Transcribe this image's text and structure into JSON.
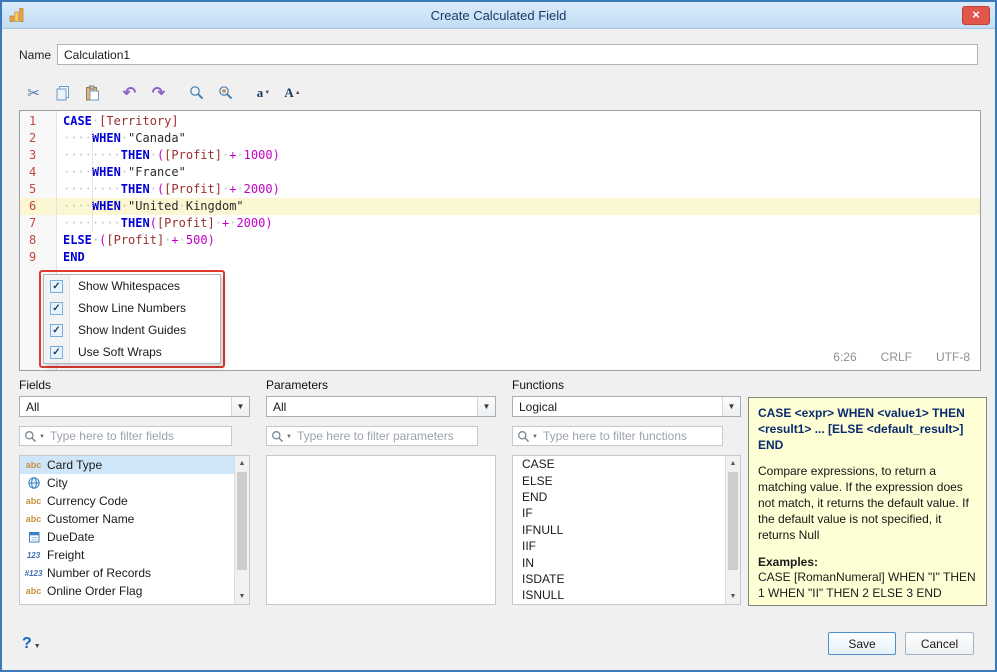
{
  "window": {
    "title": "Create Calculated Field",
    "close_glyph": "×"
  },
  "name_row": {
    "label": "Name",
    "value": "Calculation1"
  },
  "toolbar": {
    "cut_glyph": "✂",
    "undo_glyph": "↶",
    "redo_glyph": "↷",
    "font_decrease_glyph": "a",
    "font_increase_glyph": "A"
  },
  "editor": {
    "lines": [
      {
        "num": "1",
        "hl": false,
        "tokens": [
          [
            "kw",
            "CASE"
          ],
          [
            "ws",
            "·"
          ],
          [
            "field",
            "[Territory]"
          ]
        ]
      },
      {
        "num": "2",
        "hl": false,
        "tokens": [
          [
            "ws",
            "····"
          ],
          [
            "kw",
            "WHEN"
          ],
          [
            "ws",
            "·"
          ],
          [
            "str",
            "\"Canada\""
          ]
        ]
      },
      {
        "num": "3",
        "hl": false,
        "tokens": [
          [
            "ws",
            "········"
          ],
          [
            "kw",
            "THEN"
          ],
          [
            "ws",
            "·"
          ],
          [
            "par",
            "("
          ],
          [
            "field",
            "[Profit]"
          ],
          [
            "ws",
            "·"
          ],
          [
            "op",
            "+"
          ],
          [
            "ws",
            "·"
          ],
          [
            "nmb",
            "1000"
          ],
          [
            "par",
            ")"
          ]
        ]
      },
      {
        "num": "4",
        "hl": false,
        "tokens": [
          [
            "ws",
            "····"
          ],
          [
            "kw",
            "WHEN"
          ],
          [
            "ws",
            "·"
          ],
          [
            "str",
            "\"France\""
          ]
        ]
      },
      {
        "num": "5",
        "hl": false,
        "tokens": [
          [
            "ws",
            "········"
          ],
          [
            "kw",
            "THEN"
          ],
          [
            "ws",
            "·"
          ],
          [
            "par",
            "("
          ],
          [
            "field",
            "[Profit]"
          ],
          [
            "ws",
            "·"
          ],
          [
            "op",
            "+"
          ],
          [
            "ws",
            "·"
          ],
          [
            "nmb",
            "2000"
          ],
          [
            "par",
            ")"
          ]
        ]
      },
      {
        "num": "6",
        "hl": true,
        "tokens": [
          [
            "ws",
            "····"
          ],
          [
            "kw",
            "WHEN"
          ],
          [
            "ws",
            "·"
          ],
          [
            "str",
            "\"United"
          ],
          [
            "ws",
            "·"
          ],
          [
            "str",
            "Kingdom\""
          ]
        ]
      },
      {
        "num": "7",
        "hl": false,
        "tokens": [
          [
            "ws",
            "········"
          ],
          [
            "kw",
            "THEN"
          ],
          [
            "par",
            "("
          ],
          [
            "field",
            "[Profit]"
          ],
          [
            "ws",
            "·"
          ],
          [
            "op",
            "+"
          ],
          [
            "ws",
            "·"
          ],
          [
            "nmb",
            "2000"
          ],
          [
            "par",
            ")"
          ]
        ]
      },
      {
        "num": "8",
        "hl": false,
        "tokens": [
          [
            "kw",
            "ELSE"
          ],
          [
            "ws",
            "·"
          ],
          [
            "par",
            "("
          ],
          [
            "field",
            "[Profit]"
          ],
          [
            "ws",
            "·"
          ],
          [
            "op",
            "+"
          ],
          [
            "ws",
            "·"
          ],
          [
            "nmb",
            "500"
          ],
          [
            "par",
            ")"
          ]
        ]
      },
      {
        "num": "9",
        "hl": false,
        "tokens": [
          [
            "kw",
            "END"
          ]
        ]
      }
    ],
    "status": {
      "caret": "6:26",
      "eol": "CRLF",
      "encoding": "UTF-8"
    }
  },
  "context_menu": {
    "items": [
      {
        "label": "Show Whitespaces",
        "checked": true
      },
      {
        "label": "Show Line Numbers",
        "checked": true
      },
      {
        "label": "Show Indent Guides",
        "checked": true
      },
      {
        "label": "Use Soft Wraps",
        "checked": true
      }
    ]
  },
  "fields_panel": {
    "label": "Fields",
    "dropdown_value": "All",
    "filter_placeholder": "Type here to filter fields",
    "items": [
      {
        "icon": "abc",
        "label": "Card Type",
        "selected": true
      },
      {
        "icon": "globe",
        "label": "City"
      },
      {
        "icon": "abc",
        "label": "Currency Code"
      },
      {
        "icon": "abc",
        "label": "Customer Name"
      },
      {
        "icon": "calendar",
        "label": "DueDate"
      },
      {
        "icon": "num",
        "label": "Freight"
      },
      {
        "icon": "numrec",
        "label": "Number of Records"
      },
      {
        "icon": "abc",
        "label": "Online Order Flag"
      }
    ]
  },
  "parameters_panel": {
    "label": "Parameters",
    "dropdown_value": "All",
    "filter_placeholder": "Type here to filter parameters",
    "items": []
  },
  "functions_panel": {
    "label": "Functions",
    "dropdown_value": "Logical",
    "filter_placeholder": "Type here to filter functions",
    "items": [
      "CASE",
      "ELSE",
      "END",
      "IF",
      "IFNULL",
      "IIF",
      "IN",
      "ISDATE",
      "ISNULL"
    ]
  },
  "description_panel": {
    "signature": "CASE <expr> WHEN <value1> THEN <result1> ... [ELSE <default_result>] END",
    "body": "Compare expressions, to return a matching value. If the expression does not match, it returns the default value. If the default value is not specified, it returns Null",
    "examples_label": "Examples:",
    "example": "CASE [RomanNumeral] WHEN \"I\" THEN 1 WHEN \"II\" THEN 2 ELSE 3 END"
  },
  "footer": {
    "help": "?",
    "save": "Save",
    "cancel": "Cancel"
  },
  "colors": {
    "accent_border": "#3b79b8",
    "close_button": "#e2574c",
    "line_highlight": "#fcf7d3",
    "selection_blue": "#cfe6f8",
    "description_bg": "#ffffd6",
    "annotation_red": "#e0392e"
  }
}
